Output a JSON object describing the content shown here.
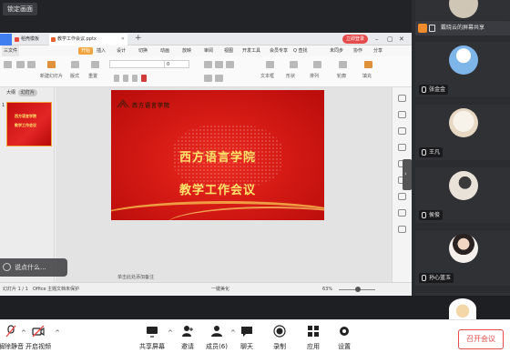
{
  "meeting": {
    "lock_view_label": "锁定画面",
    "open_meeting_label": "召开会议",
    "chat_prompt": "说点什么...",
    "bottom_toolbar": [
      {
        "label": "解除静音",
        "icon": "microphone-muted-icon"
      },
      {
        "label": "开启视频",
        "icon": "camera-off-icon"
      },
      {
        "label": "共享屏幕",
        "icon": "screen-share-icon"
      },
      {
        "label": "邀请",
        "icon": "invite-icon"
      },
      {
        "label": "成员(6)",
        "icon": "members-icon"
      },
      {
        "label": "聊天",
        "icon": "chat-icon"
      },
      {
        "label": "录制",
        "icon": "record-icon"
      },
      {
        "label": "应用",
        "icon": "apps-icon"
      },
      {
        "label": "设置",
        "icon": "settings-icon"
      }
    ]
  },
  "participants": {
    "share_label": "戴晓云的屏幕共享",
    "list": [
      {
        "name": "张金金",
        "avatar": "blue-sky-photo"
      },
      {
        "name": "王凡",
        "avatar": "white-cat-photo"
      },
      {
        "name": "侯俊",
        "avatar": "person-photo"
      },
      {
        "name": "孙心蓝玉",
        "avatar": "girl-photo"
      },
      {
        "name": "",
        "avatar": "cartoon-dog-photo"
      }
    ]
  },
  "wps": {
    "tabs": {
      "daoke": "稻壳模板",
      "doc": "教学工作会议.pptx"
    },
    "login_label": "立即登录",
    "menus": [
      "三文件",
      "开始",
      "插入",
      "设计",
      "切换",
      "动画",
      "放映",
      "审阅",
      "视图",
      "开发工具",
      "会员专享",
      "Q 查找"
    ],
    "right_menus": [
      "未同步",
      "协作",
      "分享"
    ],
    "toolbar_labels": {
      "new_slide": "新建幻灯片",
      "layout": "版式",
      "section": "节",
      "reset": "重置",
      "textbox": "文本框",
      "shapes": "形状",
      "arrange": "排列",
      "outline": "轮廓",
      "fill": "填充",
      "font_size": "0"
    },
    "pane_tabs": [
      "大纲",
      "幻灯片"
    ],
    "slide_number": "1",
    "notes_hint": "单击此处添加备注",
    "status": {
      "slide_pos": "幻灯片 1 / 1",
      "theme": "Office 主题",
      "missing_font": "文档未保护",
      "beautify": "一键美化",
      "zoom": "63%"
    }
  },
  "slide": {
    "logo_text": "西方语言学院",
    "title": "西方语言学院",
    "subtitle": "教学工作会议",
    "thumb_title": "西方语言学院",
    "thumb_subtitle": "教学工作会议"
  }
}
